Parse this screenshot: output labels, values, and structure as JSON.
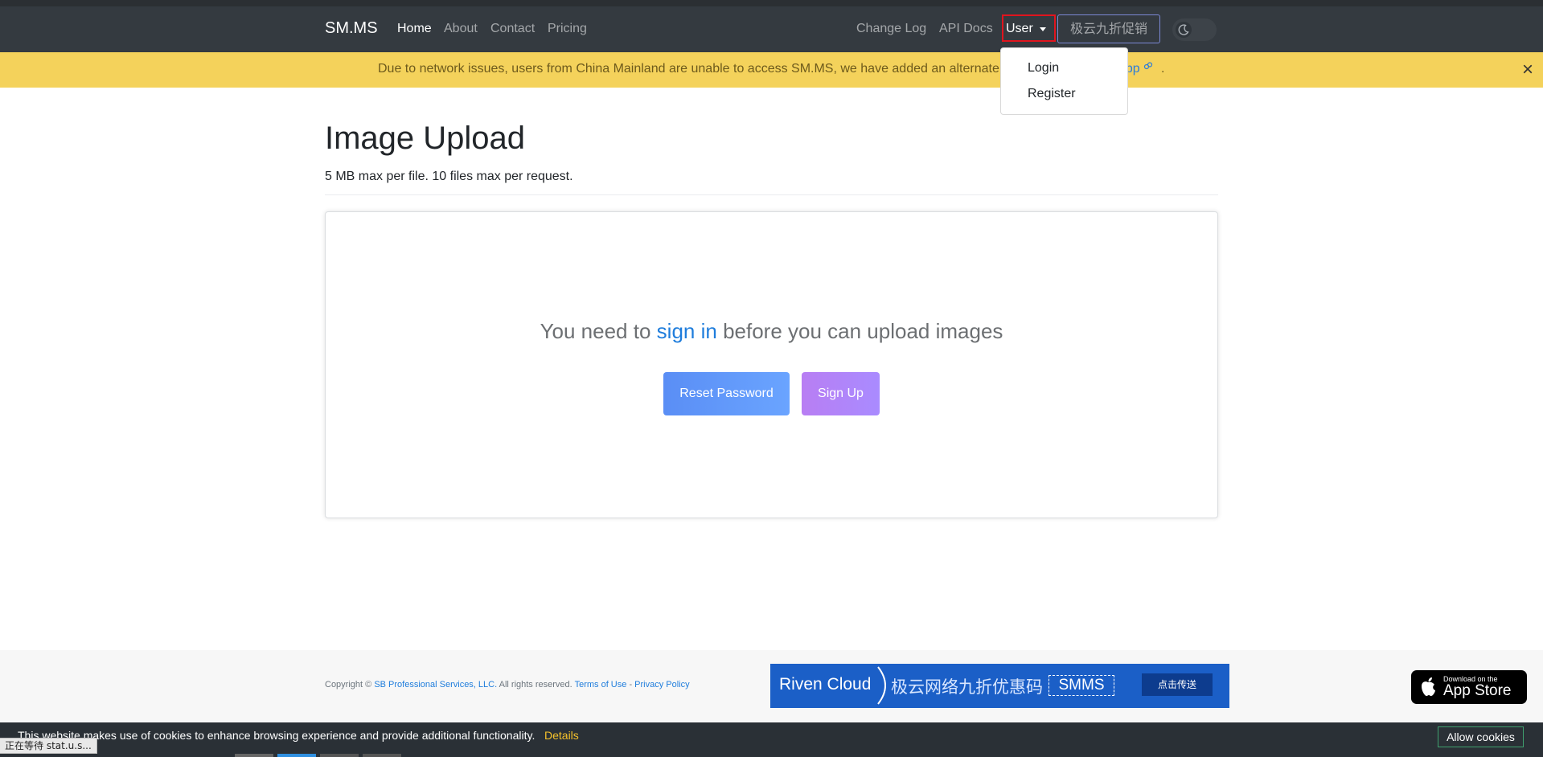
{
  "navbar": {
    "brand": "SM.MS",
    "links": [
      "Home",
      "About",
      "Contact",
      "Pricing"
    ],
    "right_links": [
      "Change Log",
      "API Docs"
    ],
    "user_label": "User",
    "promo_label": "极云九折促销",
    "user_menu": [
      "Login",
      "Register"
    ]
  },
  "alert": {
    "message": "Due to network issues, users from China Mainland are unable to access SM.MS, we have added an alternate",
    "link_text": "app",
    "trailing": "."
  },
  "main": {
    "title": "Image Upload",
    "subtitle": "5 MB max per file. 10 files max per request.",
    "message_before": "You need to",
    "message_link": "sign in",
    "message_after": "before you can upload images",
    "reset_button": "Reset Password",
    "signup_button": "Sign Up"
  },
  "footer": {
    "copyright_prefix": "Copyright ©",
    "company": "SB Professional Services, LLC.",
    "rights": "All rights reserved.",
    "terms": "Terms of Use",
    "sep": "-",
    "privacy": "Privacy Policy",
    "banner_brand": "Riven Cloud",
    "banner_text": "极云网络九折优惠码",
    "banner_code": "SMMS",
    "banner_button": "点击传送",
    "appstore_small": "Download on the",
    "appstore_big": "App Store"
  },
  "cookie": {
    "message": "This website makes use of cookies to enhance browsing experience and provide additional functionality.",
    "details": "Details",
    "allow": "Allow cookies"
  },
  "statusbar": {
    "text": "正在等待 stat.u.s..."
  },
  "colors": {
    "navbar": "#343a40",
    "alert": "#f4d25b",
    "link": "#1f7ddc",
    "highlight": "#e0141e"
  }
}
